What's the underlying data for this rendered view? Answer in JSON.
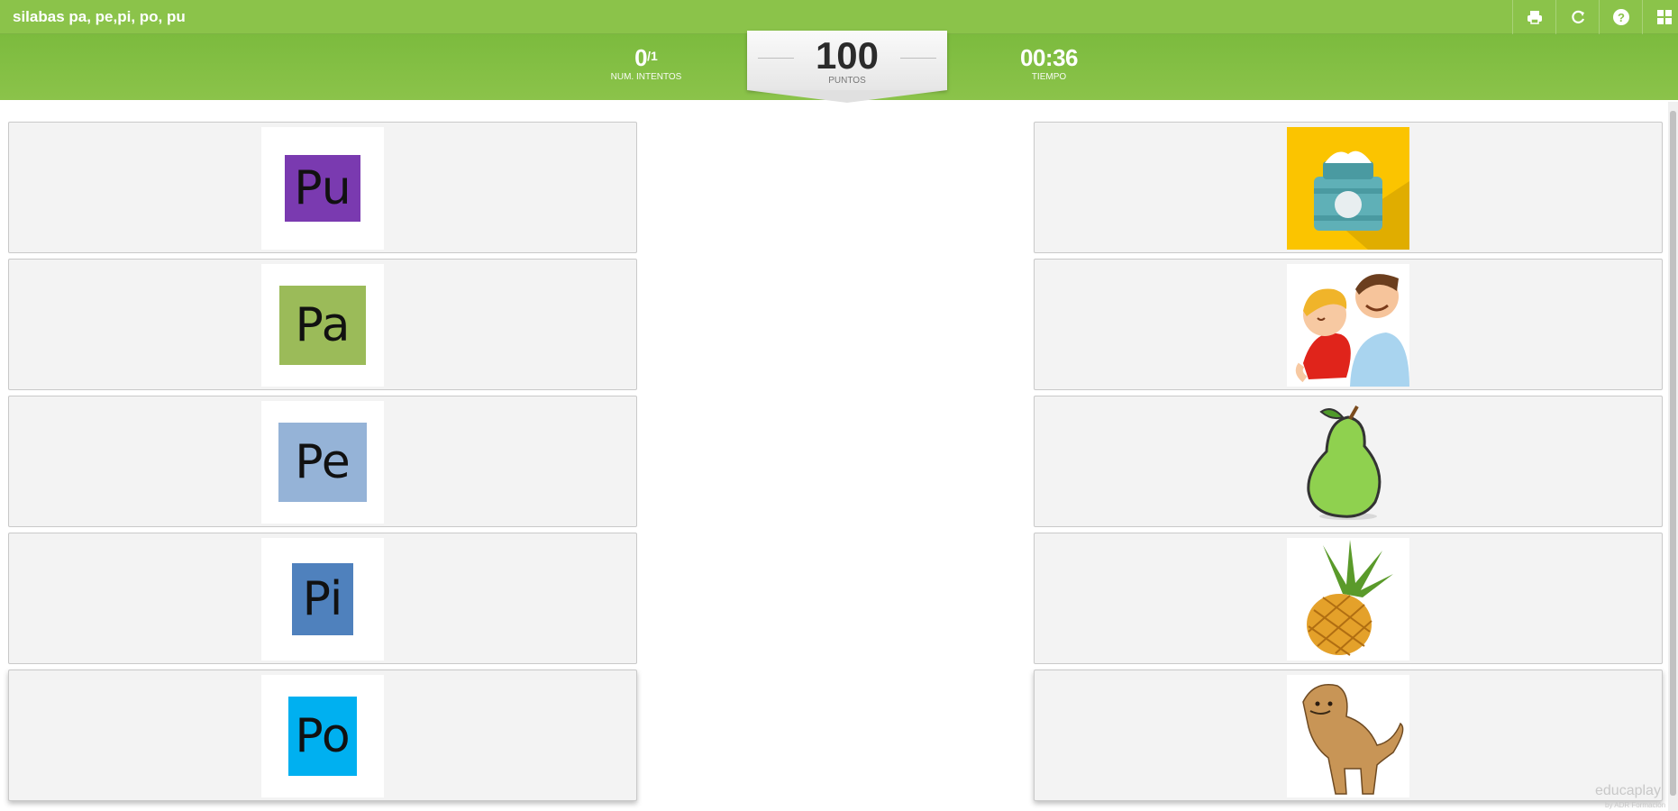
{
  "app": {
    "title": "silabas pa, pe,pi, po, pu"
  },
  "toolbar": {
    "icons": [
      "print-icon",
      "restart-icon",
      "help-icon",
      "grid-icon"
    ]
  },
  "stats": {
    "attempts_value": "0",
    "attempts_total": "/1",
    "attempts_label": "NUM. INTENTOS",
    "points_value": "100",
    "points_label": "PUNTOS",
    "time_value": "00:36",
    "time_label": "TIEMPO"
  },
  "left_cards": [
    {
      "text": "Pu",
      "color": "#7a3ab0"
    },
    {
      "text": "Pa",
      "color": "#9bbb59"
    },
    {
      "text": "Pe",
      "color": "#95b3d7"
    },
    {
      "text": "Pi",
      "color": "#4f81bd"
    },
    {
      "text": "Po",
      "color": "#00b0f0"
    }
  ],
  "right_cards": [
    {
      "image": "cream-jar-image"
    },
    {
      "image": "father-and-son-image"
    },
    {
      "image": "pear-image"
    },
    {
      "image": "pineapple-image"
    },
    {
      "image": "puma-image"
    }
  ],
  "footer": {
    "brand": "educaplay",
    "brand_sub": "by ADR Formación"
  },
  "colors": {
    "accent": "#8bc34a",
    "card_bg": "#f3f3f3"
  }
}
